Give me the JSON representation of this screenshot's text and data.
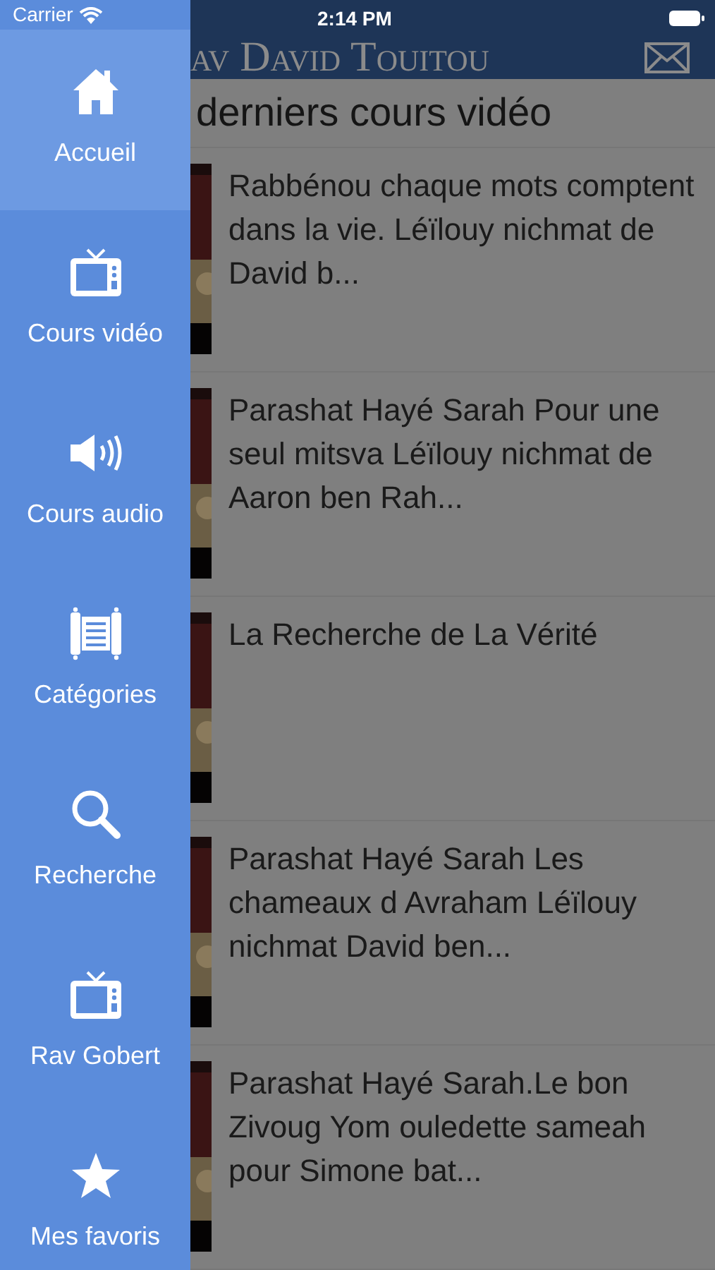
{
  "status_bar": {
    "carrier": "Carrier",
    "time": "2:14 PM"
  },
  "header": {
    "title": "av David Touitou"
  },
  "section_title": "derniers cours vidéo",
  "videos": [
    {
      "title": "Rabbénou  chaque mots comptent dans la vie. Léïlouy nichmat de David b..."
    },
    {
      "title": "Parashat Hayé Sarah Pour une seul mitsva   Léïlouy nichmat de Aaron ben Rah..."
    },
    {
      "title": "La Recherche de La Vérité"
    },
    {
      "title": "Parashat Hayé Sarah Les chameaux d Avraham Léïlouy nichmat David ben..."
    },
    {
      "title": "Parashat Hayé Sarah.Le bon Zivoug Yom ouledette sameah pour Simone bat..."
    }
  ],
  "sidebar": {
    "items": [
      {
        "kind": "home",
        "label": "Accueil",
        "selected": true
      },
      {
        "kind": "tv",
        "label": "Cours vidéo",
        "selected": false
      },
      {
        "kind": "speaker",
        "label": "Cours audio",
        "selected": false
      },
      {
        "kind": "scroll",
        "label": "Catégories",
        "selected": false
      },
      {
        "kind": "search",
        "label": "Recherche",
        "selected": false
      },
      {
        "kind": "tv",
        "label": "Rav Gobert",
        "selected": false
      },
      {
        "kind": "star",
        "label": "Mes favoris",
        "selected": false
      }
    ]
  }
}
